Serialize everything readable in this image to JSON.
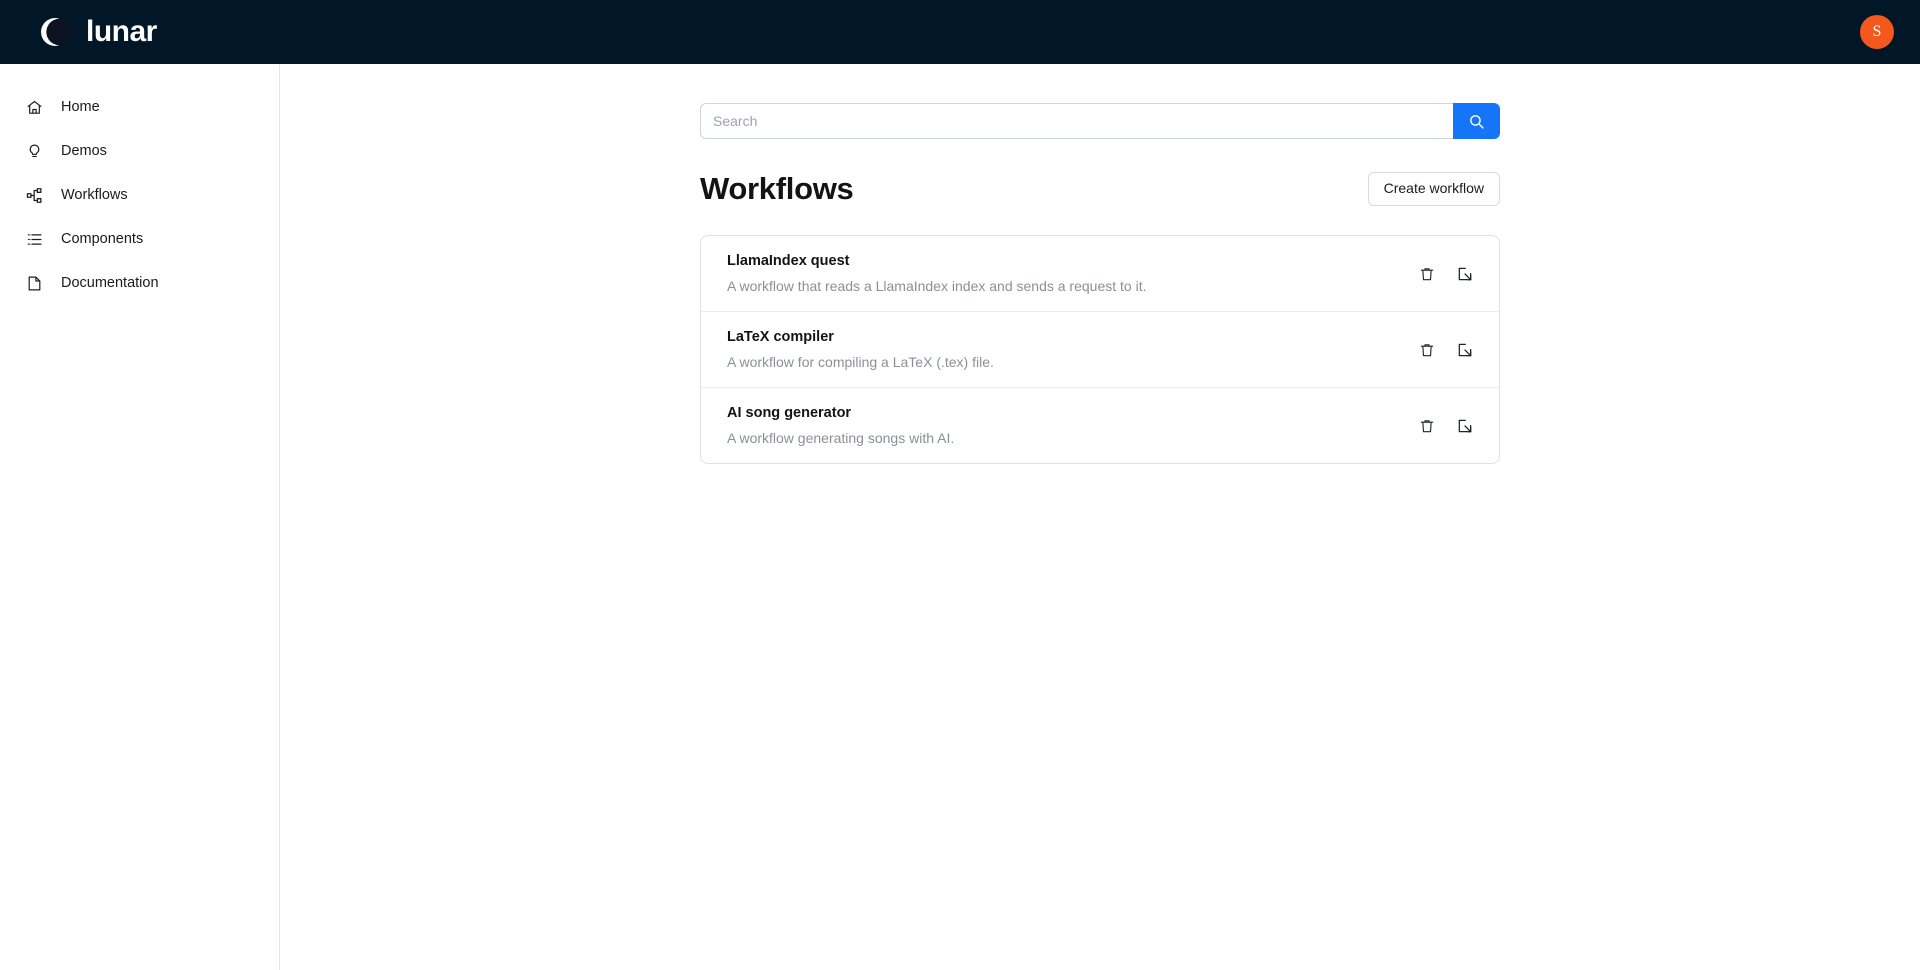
{
  "header": {
    "brand_name": "lunar",
    "logo_icon": "crescent-moon-icon",
    "avatar_initial": "S",
    "avatar_color": "#f4581c",
    "background_color": "#011627"
  },
  "sidebar": {
    "items": [
      {
        "label": "Home",
        "icon": "home-icon"
      },
      {
        "label": "Demos",
        "icon": "lightbulb-icon"
      },
      {
        "label": "Workflows",
        "icon": "sitemap-icon"
      },
      {
        "label": "Components",
        "icon": "list-icon"
      },
      {
        "label": "Documentation",
        "icon": "document-icon"
      }
    ]
  },
  "search": {
    "placeholder": "Search",
    "value": "",
    "button_icon": "search-icon",
    "button_color": "#1575f8"
  },
  "main": {
    "title": "Workflows",
    "create_button": "Create workflow",
    "row_actions": {
      "delete_icon": "trash-icon",
      "open_icon": "open-in-box-icon"
    },
    "workflows": [
      {
        "name": "LlamaIndex quest",
        "description": "A workflow that reads a LlamaIndex index and sends a request to it."
      },
      {
        "name": "LaTeX compiler",
        "description": "A workflow for compiling a LaTeX (.tex) file."
      },
      {
        "name": "AI song generator",
        "description": "A workflow generating songs with AI."
      }
    ]
  }
}
